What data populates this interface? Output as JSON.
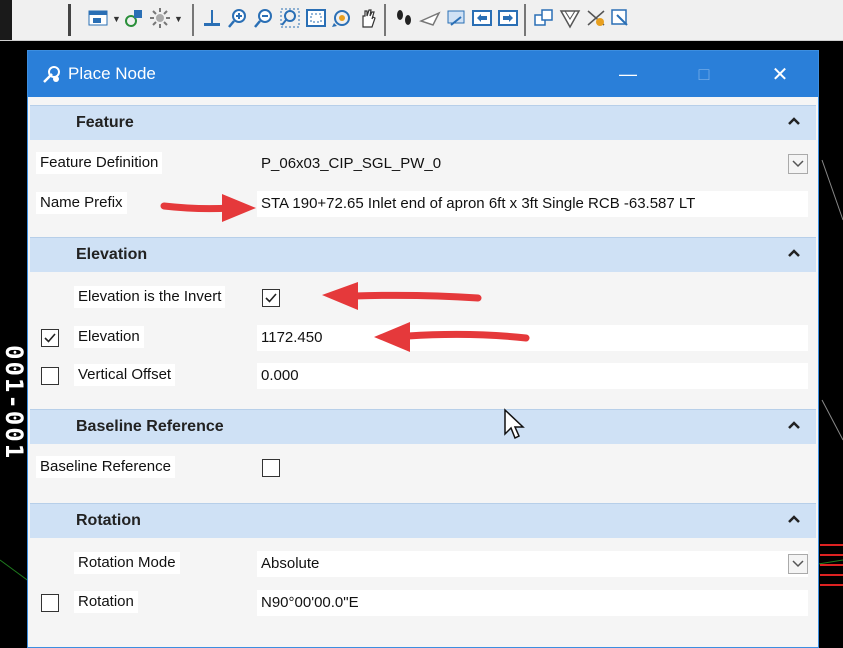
{
  "toolbar": {
    "icons": [
      "view-icon",
      "display-style-icon",
      "lighting-icon",
      "level-icon",
      "zoom-in-icon",
      "zoom-out-icon",
      "window-area-icon",
      "fit-view-icon",
      "rotate-view-icon",
      "pan-icon",
      "walk-icon",
      "fly-icon",
      "camera-icon",
      "previous-view-icon",
      "next-view-icon",
      "copy-view-icon",
      "clip-volume-icon",
      "clip-mask-icon",
      "section-icon"
    ]
  },
  "cad": {
    "vertical_text": "001-001"
  },
  "dialog": {
    "title": "Place Node",
    "minimize": "—",
    "maximize": "□",
    "close": "✕",
    "sections": {
      "feature": {
        "title": "Feature",
        "feature_definition_label": "Feature Definition",
        "feature_definition_value": "P_06x03_CIP_SGL_PW_0",
        "name_prefix_label": "Name Prefix",
        "name_prefix_value": "STA 190+72.65 Inlet end of apron 6ft x 3ft Single RCB -63.587 LT"
      },
      "elevation": {
        "title": "Elevation",
        "invert_label": "Elevation is the Invert",
        "invert_checked": true,
        "elevation_label": "Elevation",
        "elevation_checked": true,
        "elevation_value": "1172.450",
        "vertical_offset_label": "Vertical Offset",
        "vertical_offset_checked": false,
        "vertical_offset_value": "0.000"
      },
      "baseline": {
        "title": "Baseline Reference",
        "baseline_label": "Baseline Reference",
        "baseline_checked": false
      },
      "rotation": {
        "title": "Rotation",
        "mode_label": "Rotation Mode",
        "mode_value": "Absolute",
        "rotation_label": "Rotation",
        "rotation_checked": false,
        "rotation_value": "N90°00'00.0\"E"
      }
    }
  },
  "colors": {
    "titlebar": "#2a7fd9",
    "section_header": "#cfe1f5",
    "annotation_arrow": "#e5393b"
  }
}
